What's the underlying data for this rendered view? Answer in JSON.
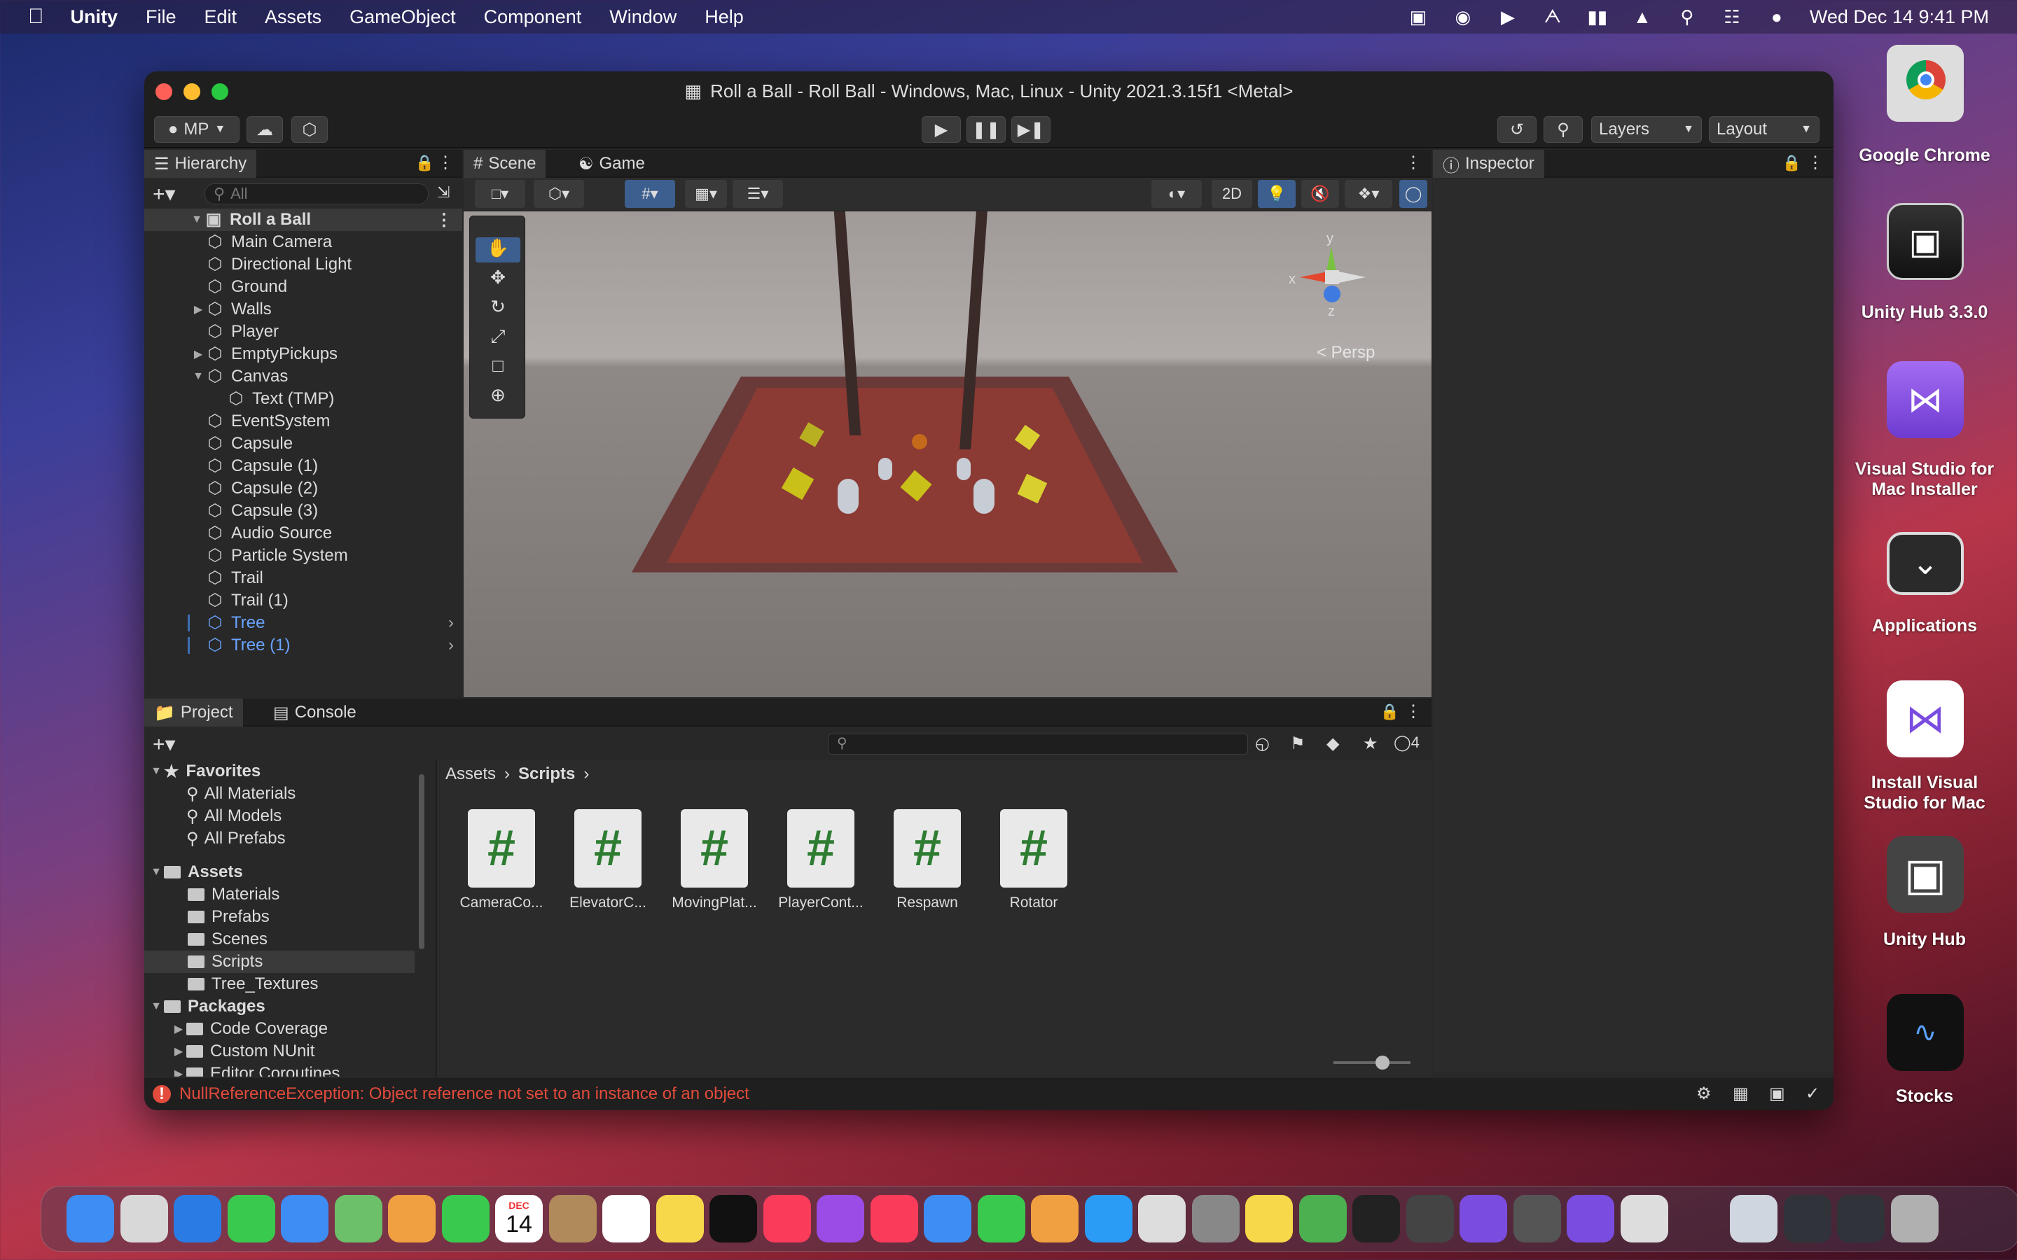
{
  "menubar": {
    "app": "Unity",
    "items": [
      "File",
      "Edit",
      "Assets",
      "GameObject",
      "Component",
      "Window",
      "Help"
    ],
    "clock": "Wed Dec 14  9:41 PM"
  },
  "window": {
    "title": "Roll a Ball - Roll Ball - Windows, Mac, Linux - Unity 2021.3.15f1 <Metal>"
  },
  "toolbar": {
    "account": "MP",
    "layers": "Layers",
    "layout": "Layout"
  },
  "hierarchy": {
    "tab": "Hierarchy",
    "search_placeholder": "All",
    "scene": "Roll a Ball",
    "items": [
      {
        "label": "Main Camera",
        "indent": 1
      },
      {
        "label": "Directional Light",
        "indent": 1
      },
      {
        "label": "Ground",
        "indent": 1
      },
      {
        "label": "Walls",
        "indent": 1
      },
      {
        "label": "Player",
        "indent": 1
      },
      {
        "label": "EmptyPickups",
        "indent": 1
      },
      {
        "label": "Canvas",
        "indent": 1
      },
      {
        "label": "Text (TMP)",
        "indent": 2
      },
      {
        "label": "EventSystem",
        "indent": 1
      },
      {
        "label": "Capsule",
        "indent": 1
      },
      {
        "label": "Capsule (1)",
        "indent": 1
      },
      {
        "label": "Capsule (2)",
        "indent": 1
      },
      {
        "label": "Capsule (3)",
        "indent": 1
      },
      {
        "label": "Audio Source",
        "indent": 1
      },
      {
        "label": "Particle System",
        "indent": 1
      },
      {
        "label": "Trail",
        "indent": 1
      },
      {
        "label": "Trail (1)",
        "indent": 1
      },
      {
        "label": "Tree",
        "indent": 1
      },
      {
        "label": "Tree (1)",
        "indent": 1
      }
    ]
  },
  "scene": {
    "tab_scene": "Scene",
    "tab_game": "Game",
    "btn_2d": "2D",
    "persp": "< Persp",
    "axes": {
      "x": "x",
      "y": "y",
      "z": "z"
    }
  },
  "inspector": {
    "tab": "Inspector"
  },
  "project": {
    "tab_project": "Project",
    "tab_console": "Console",
    "breadcrumb": [
      "Assets",
      "Scripts"
    ],
    "hidden_count": "4",
    "favorites": {
      "label": "Favorites",
      "items": [
        "All Materials",
        "All Models",
        "All Prefabs"
      ]
    },
    "assets": {
      "label": "Assets",
      "items": [
        "Materials",
        "Prefabs",
        "Scenes",
        "Scripts",
        "Tree_Textures"
      ]
    },
    "packages": {
      "label": "Packages",
      "items": [
        "Code Coverage",
        "Custom NUnit",
        "Editor Coroutines"
      ]
    },
    "scripts": [
      "CameraCo...",
      "ElevatorC...",
      "MovingPlat...",
      "PlayerCont...",
      "Respawn",
      "Rotator"
    ]
  },
  "status": {
    "error": "NullReferenceException: Object reference not set to an instance of an object"
  },
  "desktop": [
    {
      "label": "Google Chrome"
    },
    {
      "label": "Unity Hub 3.3.0"
    },
    {
      "label": "Visual Studio for Mac Installer"
    },
    {
      "label": "Applications"
    },
    {
      "label": "Install Visual Studio for Mac"
    },
    {
      "label": "Unity Hub"
    },
    {
      "label": "Stocks"
    }
  ],
  "dock": {
    "calendar_month": "DEC",
    "calendar_day": "14"
  },
  "colors": {
    "accent": "#3d6fb3",
    "error": "#e34b3c",
    "script_hash": "#2e7d32"
  }
}
